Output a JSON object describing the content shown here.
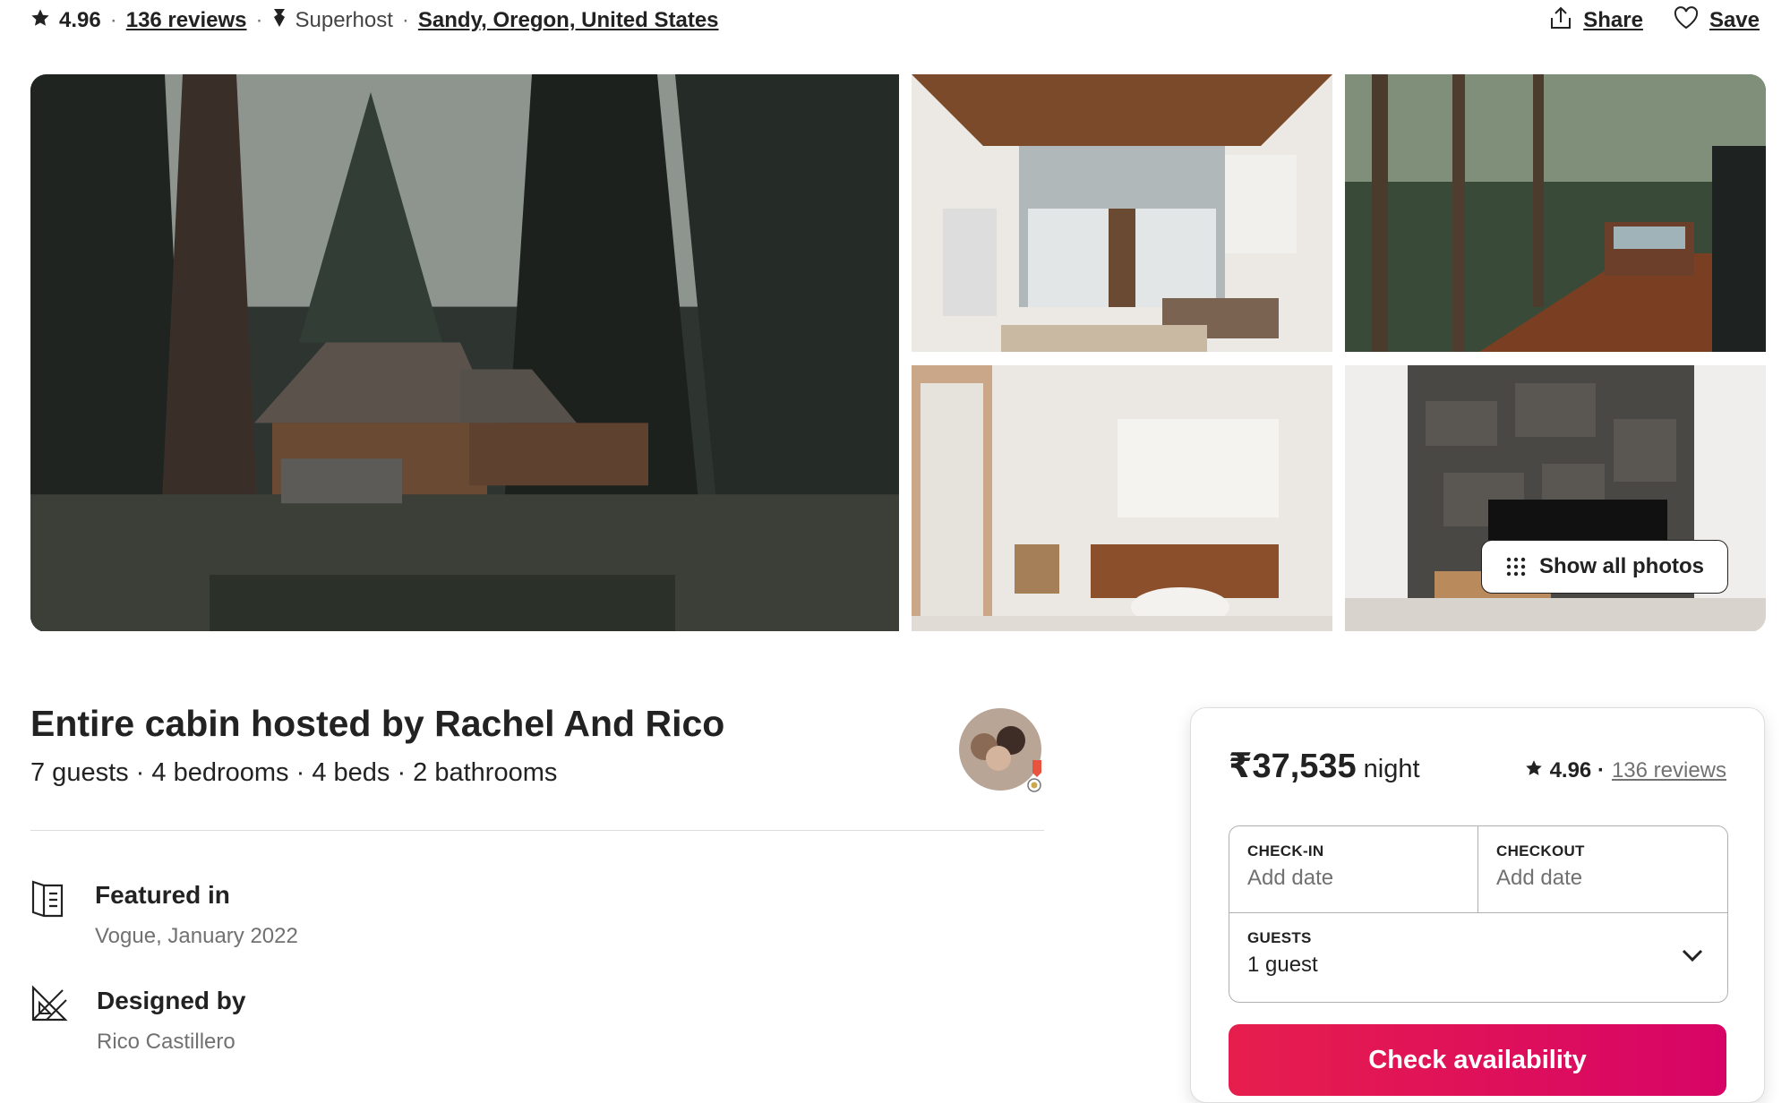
{
  "header": {
    "rating": "4.96",
    "reviews_link": "136 reviews",
    "separator": "·",
    "superhost": "Superhost",
    "location": "Sandy, Oregon, United States",
    "share_label": "Share",
    "save_label": "Save"
  },
  "gallery": {
    "show_all_label": "Show all photos"
  },
  "listing": {
    "title": "Entire cabin hosted by Rachel And Rico",
    "details": "7 guests · 4 bedrooms · 4 beds · 2 bathrooms"
  },
  "highlights": [
    {
      "icon": "magazine-icon",
      "title": "Featured in",
      "subtitle": "Vogue, January 2022"
    },
    {
      "icon": "designer-tools-icon",
      "title": "Designed by",
      "subtitle": "Rico Castillero"
    }
  ],
  "booking": {
    "price": "₹37,535",
    "per": "night",
    "rating": "4.96 ·",
    "reviews_link": "136 reviews",
    "checkin_label": "CHECK-IN",
    "checkin_value": "Add date",
    "checkout_label": "CHECKOUT",
    "checkout_value": "Add date",
    "guests_label": "GUESTS",
    "guests_value": "1 guest",
    "cta_label": "Check availability"
  },
  "colors": {
    "brand": "#e61e4d",
    "text": "#222222",
    "muted": "#717171",
    "border": "#dddddd"
  }
}
